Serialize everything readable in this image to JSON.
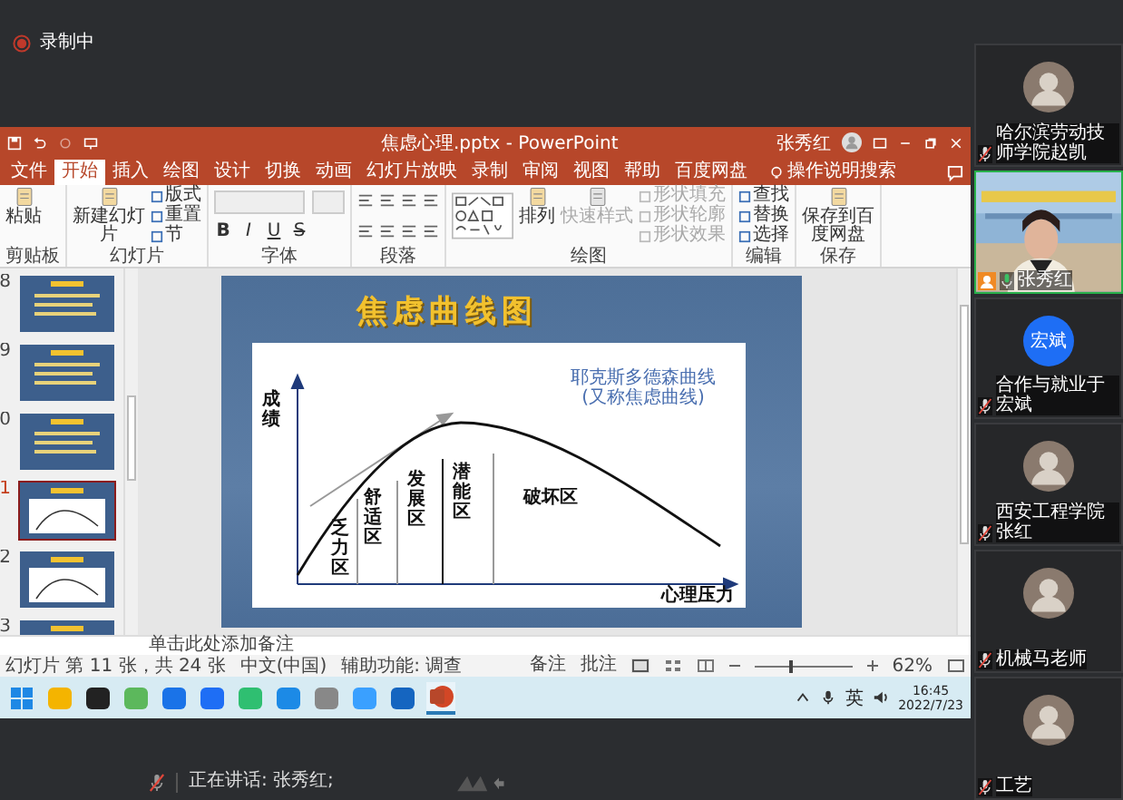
{
  "recording": {
    "label": "录制中"
  },
  "powerpoint": {
    "title": "焦虑心理.pptx - PowerPoint",
    "user": "张秀红",
    "tabs": [
      {
        "label": "文件",
        "selected": false
      },
      {
        "label": "开始",
        "selected": true
      },
      {
        "label": "插入",
        "selected": false
      },
      {
        "label": "绘图",
        "selected": false
      },
      {
        "label": "设计",
        "selected": false
      },
      {
        "label": "切换",
        "selected": false
      },
      {
        "label": "动画",
        "selected": false
      },
      {
        "label": "幻灯片放映",
        "selected": false
      },
      {
        "label": "录制",
        "selected": false
      },
      {
        "label": "审阅",
        "selected": false
      },
      {
        "label": "视图",
        "selected": false
      },
      {
        "label": "帮助",
        "selected": false
      },
      {
        "label": "百度网盘",
        "selected": false
      }
    ],
    "search": {
      "placeholder": "操作说明搜索"
    },
    "ribbon": [
      {
        "label": "剪贴板",
        "kind": "clipboard",
        "items": [
          {
            "label": "粘贴",
            "kind": "large",
            "disabled": false
          }
        ]
      },
      {
        "label": "幻灯片",
        "kind": "slides",
        "items": [
          {
            "label": "新建幻灯片",
            "kind": "large",
            "disabled": false
          },
          {
            "label": "版式",
            "kind": "small",
            "disabled": false
          },
          {
            "label": "重置",
            "kind": "small",
            "disabled": false
          },
          {
            "label": "节",
            "kind": "small",
            "disabled": false
          }
        ]
      },
      {
        "label": "字体",
        "kind": "font",
        "items": [
          {
            "label": "B",
            "kind": "glyph",
            "disabled": false
          },
          {
            "label": "I",
            "kind": "glyph",
            "disabled": false
          },
          {
            "label": "U",
            "kind": "glyph",
            "disabled": false
          },
          {
            "label": "S",
            "kind": "glyph",
            "disabled": false
          }
        ]
      },
      {
        "label": "段落",
        "kind": "paragraph"
      },
      {
        "label": "绘图",
        "kind": "drawing",
        "items": [
          {
            "label": "排列",
            "kind": "large",
            "disabled": false
          },
          {
            "label": "快速样式",
            "kind": "large",
            "disabled": true
          },
          {
            "label": "形状填充",
            "kind": "small",
            "disabled": true
          },
          {
            "label": "形状轮廓",
            "kind": "small",
            "disabled": true
          },
          {
            "label": "形状效果",
            "kind": "small",
            "disabled": true
          }
        ]
      },
      {
        "label": "编辑",
        "kind": "editing",
        "items": [
          {
            "label": "查找",
            "kind": "small",
            "disabled": false
          },
          {
            "label": "替换",
            "kind": "small",
            "disabled": false
          },
          {
            "label": "选择",
            "kind": "small",
            "disabled": false
          }
        ]
      },
      {
        "label": "保存",
        "kind": "save",
        "items": [
          {
            "label": "保存到百度网盘",
            "kind": "large",
            "disabled": false
          }
        ]
      }
    ],
    "thumbnails": [
      {
        "number": "8",
        "kind": "text",
        "selected": false
      },
      {
        "number": "9",
        "kind": "text",
        "selected": false
      },
      {
        "number": "0",
        "kind": "text",
        "selected": false
      },
      {
        "number": "1",
        "kind": "chart",
        "selected": true
      },
      {
        "number": "2",
        "kind": "chart",
        "selected": false
      },
      {
        "number": "3",
        "kind": "text",
        "selected": false
      }
    ],
    "slide": {
      "title": "焦虑曲线图",
      "y_label": "成绩",
      "x_label": "心理压力",
      "note_lines": [
        "耶克斯多德森曲线",
        "(又称焦虑曲线)"
      ],
      "zones": [
        {
          "label": "乏力区",
          "kind": "vertical"
        },
        {
          "label": "舒适区",
          "kind": "vertical"
        },
        {
          "label": "发展区",
          "kind": "vertical"
        },
        {
          "label": "潜能区",
          "kind": "vertical"
        },
        {
          "label": "破坏区",
          "kind": "horizontal"
        }
      ]
    },
    "notes_placeholder": "单击此处添加备注",
    "status_bar": {
      "slide_info": "幻灯片 第 11 张，共 24 张",
      "language": "中文(中国)",
      "accessibility": "辅助功能: 调查",
      "notes": "备注",
      "comments": "批注",
      "zoom_slider": {
        "level": 0.38
      },
      "zoom": "62%"
    }
  },
  "taskbar": {
    "ime": "英",
    "time": "16:45",
    "date": "2022/7/23"
  },
  "participants": [
    {
      "name": "哈尔滨劳动技师学院赵凯",
      "kind": "avatar",
      "muted": true,
      "speaking": false,
      "host": false
    },
    {
      "name": "张秀红",
      "kind": "video",
      "muted": false,
      "speaking": true,
      "host": true
    },
    {
      "name": "合作与就业于宏斌",
      "kind": "initials",
      "initials": "宏斌",
      "muted": true,
      "speaking": false,
      "host": false
    },
    {
      "name": "西安工程学院张红",
      "kind": "avatar",
      "muted": true,
      "speaking": false,
      "host": false
    },
    {
      "name": "机械马老师",
      "kind": "avatar",
      "muted": true,
      "speaking": false,
      "host": false
    },
    {
      "name": "工艺",
      "kind": "avatar",
      "muted": true,
      "speaking": false,
      "host": false
    }
  ],
  "speaking": {
    "label": "正在讲话: 张秀红;"
  }
}
